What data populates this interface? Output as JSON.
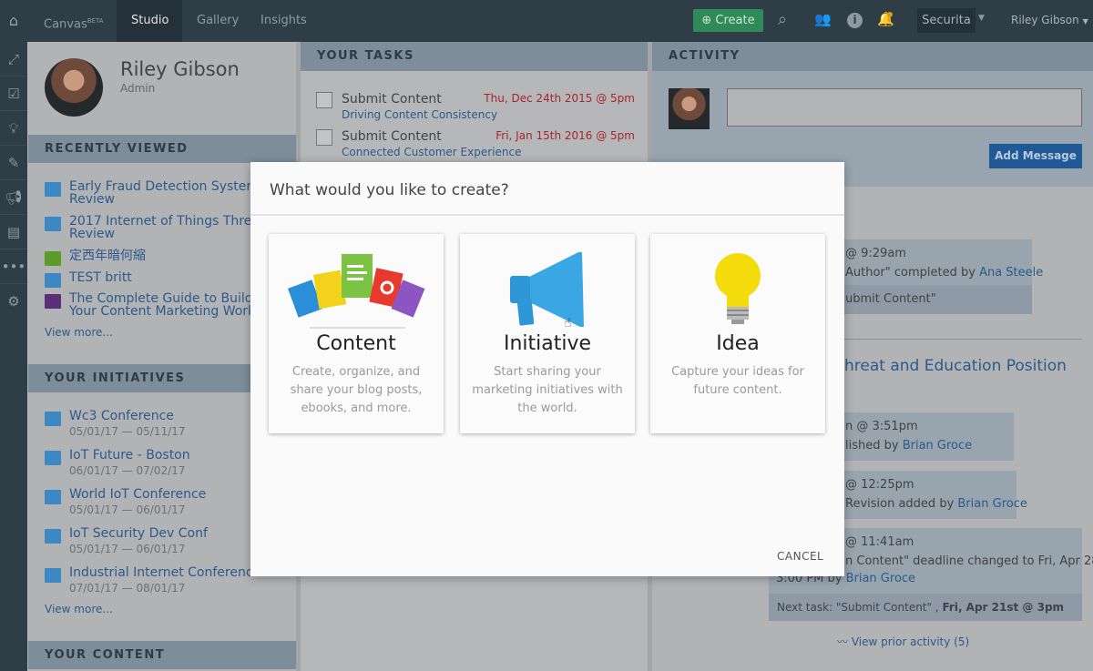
{
  "topbar": {
    "canvas": "Canvas",
    "beta": "BETA",
    "tabs": [
      "Studio",
      "Gallery",
      "Insights"
    ],
    "create": "Create",
    "workspace": "Securita",
    "user": "Riley Gibson"
  },
  "profile": {
    "name": "Riley Gibson",
    "role": "Admin"
  },
  "recently_viewed": {
    "title": "RECENTLY VIEWED",
    "items": [
      {
        "line1": "Early Fraud Detection System",
        "line2": "Review",
        "type": "blog"
      },
      {
        "line1": "2017 Internet of Things Threa",
        "line2": "Review",
        "type": "blog"
      },
      {
        "line1": "定西年暗何縮",
        "type": "image"
      },
      {
        "line1": "TEST britt",
        "type": "blog"
      },
      {
        "line1": "The Complete Guide to Buildi",
        "line2": "Your Content Marketing Work",
        "type": "email"
      }
    ],
    "more": "View more..."
  },
  "initiatives": {
    "title": "YOUR INITIATIVES",
    "items": [
      {
        "name": "Wc3 Conference",
        "dates": "05/01/17 — 05/11/17"
      },
      {
        "name": "IoT Future - Boston",
        "dates": "06/01/17 — 07/02/17"
      },
      {
        "name": "World IoT Conference",
        "dates": "05/01/17 — 06/01/17"
      },
      {
        "name": "IoT Security Dev Conf",
        "dates": "05/01/17 — 06/01/17"
      },
      {
        "name": "Industrial Internet Conferenc",
        "dates": "07/01/17 — 08/01/17"
      }
    ],
    "more": "View more..."
  },
  "your_content": {
    "title": "YOUR CONTENT"
  },
  "tasks": {
    "title": "YOUR TASKS",
    "items": [
      {
        "task": "Submit Content",
        "project": "Driving Content Consistency",
        "due": "Thu, Dec 24th 2015 @ 5pm"
      },
      {
        "task": "Submit Content",
        "project": "Connected Customer Experience",
        "due": "Fri, Jan 15th 2016 @ 5pm"
      }
    ]
  },
  "activity": {
    "title": "ACTIVITY",
    "add_message": "Add Message",
    "entries": [
      {
        "time": "@ 9:29am",
        "text": "Author\" completed by ",
        "who": "Ana Steele",
        "extra": "ubmit Content\""
      },
      {
        "time": "n @ 3:51pm",
        "text": "lished by ",
        "who": "Brian Groce"
      },
      {
        "time": "@ 12:25pm",
        "text": "Revision added by ",
        "who": "Brian Groce"
      },
      {
        "time": "@ 11:41am",
        "text": "n Content\" deadline changed to Fri, Apr 28",
        "text2": "3:00 PM by ",
        "who": "Brian Groce"
      }
    ],
    "heading": "hreat and Education Position",
    "next_task_label": "Next task: \"Submit Content\" , ",
    "next_task_date": "Fri, Apr 21st @ 3pm",
    "prior": "View prior activity (5)"
  },
  "modal": {
    "title": "What would you like to create?",
    "cancel": "CANCEL",
    "options": [
      {
        "title": "Content",
        "desc": "Create, organize, and share your blog posts, ebooks, and more."
      },
      {
        "title": "Initiative",
        "desc": "Start sharing your marketing initiatives with the world."
      },
      {
        "title": "Idea",
        "desc": "Capture your ideas for future content."
      }
    ]
  }
}
